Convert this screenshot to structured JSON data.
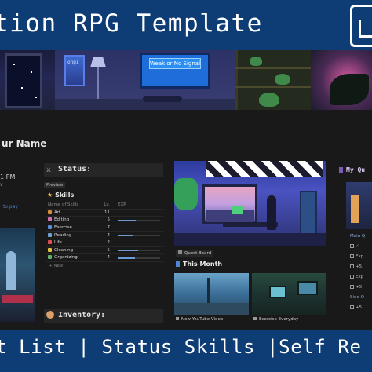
{
  "banner": {
    "title": "tion RPG Template",
    "footer": "t List | Status Skills |Self Re"
  },
  "cover": {
    "tv_label": "Weak or No Signal",
    "poster_text": "onpi"
  },
  "page": {
    "name": "ur Name"
  },
  "left": {
    "time": "1 PM",
    "sub": "v",
    "link": "to pay"
  },
  "status": {
    "title": "Status:",
    "icon": "crossed-swords-icon",
    "preview_tab": "Preview",
    "skills_title": "Skills",
    "columns": [
      "Name of Skills",
      "Lv.",
      "EXP"
    ],
    "skills": [
      {
        "name": "Art",
        "level": "11",
        "exp": 0.58,
        "icon_color": "#d8903a"
      },
      {
        "name": "Editing",
        "level": "5",
        "exp": 0.42,
        "icon_color": "#d070b0"
      },
      {
        "name": "Exercise",
        "level": "7",
        "exp": 0.66,
        "icon_color": "#5a8ad8"
      },
      {
        "name": "Reading",
        "level": "4",
        "exp": 0.36,
        "icon_color": "#70a0d0"
      },
      {
        "name": "Life",
        "level": "2",
        "exp": 0.3,
        "icon_color": "#e05050"
      },
      {
        "name": "Cleaning",
        "level": "5",
        "exp": 0.48,
        "icon_color": "#e0c040"
      },
      {
        "name": "Organizing",
        "level": "4",
        "exp": 0.4,
        "icon_color": "#60b070"
      }
    ],
    "new_label": "+ New",
    "inventory_title": "Inventory:"
  },
  "middle": {
    "quest_board": "Quest Board",
    "this_month": "This Month",
    "thumbs": [
      {
        "caption": "New YouTube Video"
      },
      {
        "caption": "Exercise Everyday"
      }
    ]
  },
  "right": {
    "title": "My Qu",
    "items": [
      {
        "text": "Main Q",
        "head": true
      },
      {
        "text": "✓",
        "head": false
      },
      {
        "text": "Exp",
        "head": false
      },
      {
        "text": "+5",
        "head": false
      },
      {
        "text": "Exp",
        "head": false
      },
      {
        "text": "+5",
        "head": false
      },
      {
        "text": "Side Q",
        "head": true
      },
      {
        "text": "+5",
        "head": false
      }
    ]
  }
}
